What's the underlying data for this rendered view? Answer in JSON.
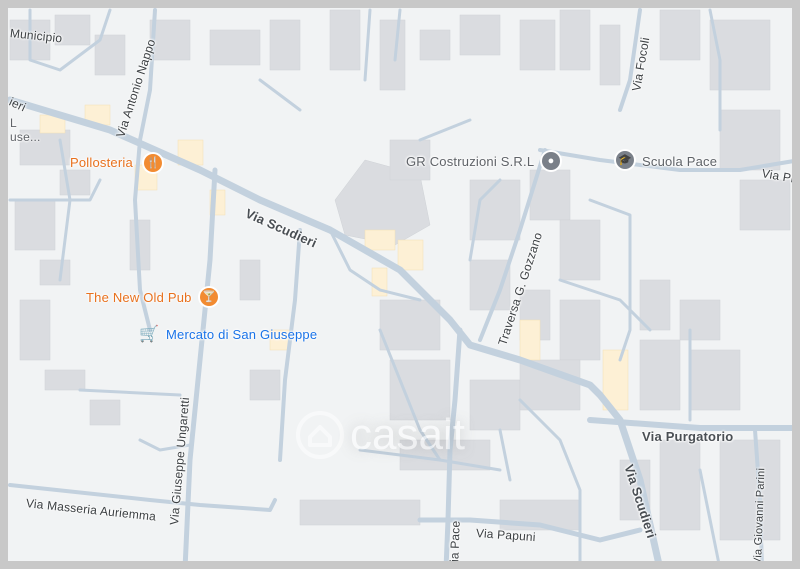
{
  "map": {
    "streets": {
      "via_scudieri_main": "Via Scudieri",
      "via_scudieri_se": "Via Scudieri",
      "via_antonio_nappo": "Via Antonio Nappo",
      "via_giuseppe_ungaretti": "Via Giuseppe Ungaretti",
      "via_masseria_auriemma": "Via Masseria Auriemma",
      "via_pace": "Via Pace",
      "via_papuni": "Via Papuni",
      "via_purgatorio": "Via Purgatorio",
      "traversa_g_gozzano": "Traversa G. Gozzano",
      "via_focoli": "Via Focoli",
      "via_giovanni_parini": "Via Giovanni Parini",
      "municipio": "Municipio",
      "via_pia_partial": "Via Pia",
      "partial_ieri": "ieri",
      "partial_l_use": "L\nuse..."
    },
    "pois": {
      "pollosteria": {
        "label": "Pollosteria",
        "icon": "restaurant-icon",
        "color": "#e8711e"
      },
      "the_new_old_pub": {
        "label": "The New Old Pub",
        "icon": "bar-icon",
        "color": "#e8711e"
      },
      "mercato": {
        "label": "Mercato di San Giuseppe",
        "icon": "shopping-cart-icon",
        "color": "#1a73e8"
      },
      "gr_costruzioni": {
        "label": "GR Costruzioni S.R.L",
        "icon": "pin-icon",
        "color": "#5f6368"
      },
      "scuola_pace": {
        "label": "Scuola Pace",
        "icon": "school-icon",
        "color": "#5f6368"
      }
    },
    "watermark": "casait",
    "colors": {
      "background": "#f1f3f4",
      "building": "#dadce0",
      "road": "#c3d1de",
      "highlight_building": "#fdf0d5",
      "frame": "#c8c8c8"
    }
  }
}
